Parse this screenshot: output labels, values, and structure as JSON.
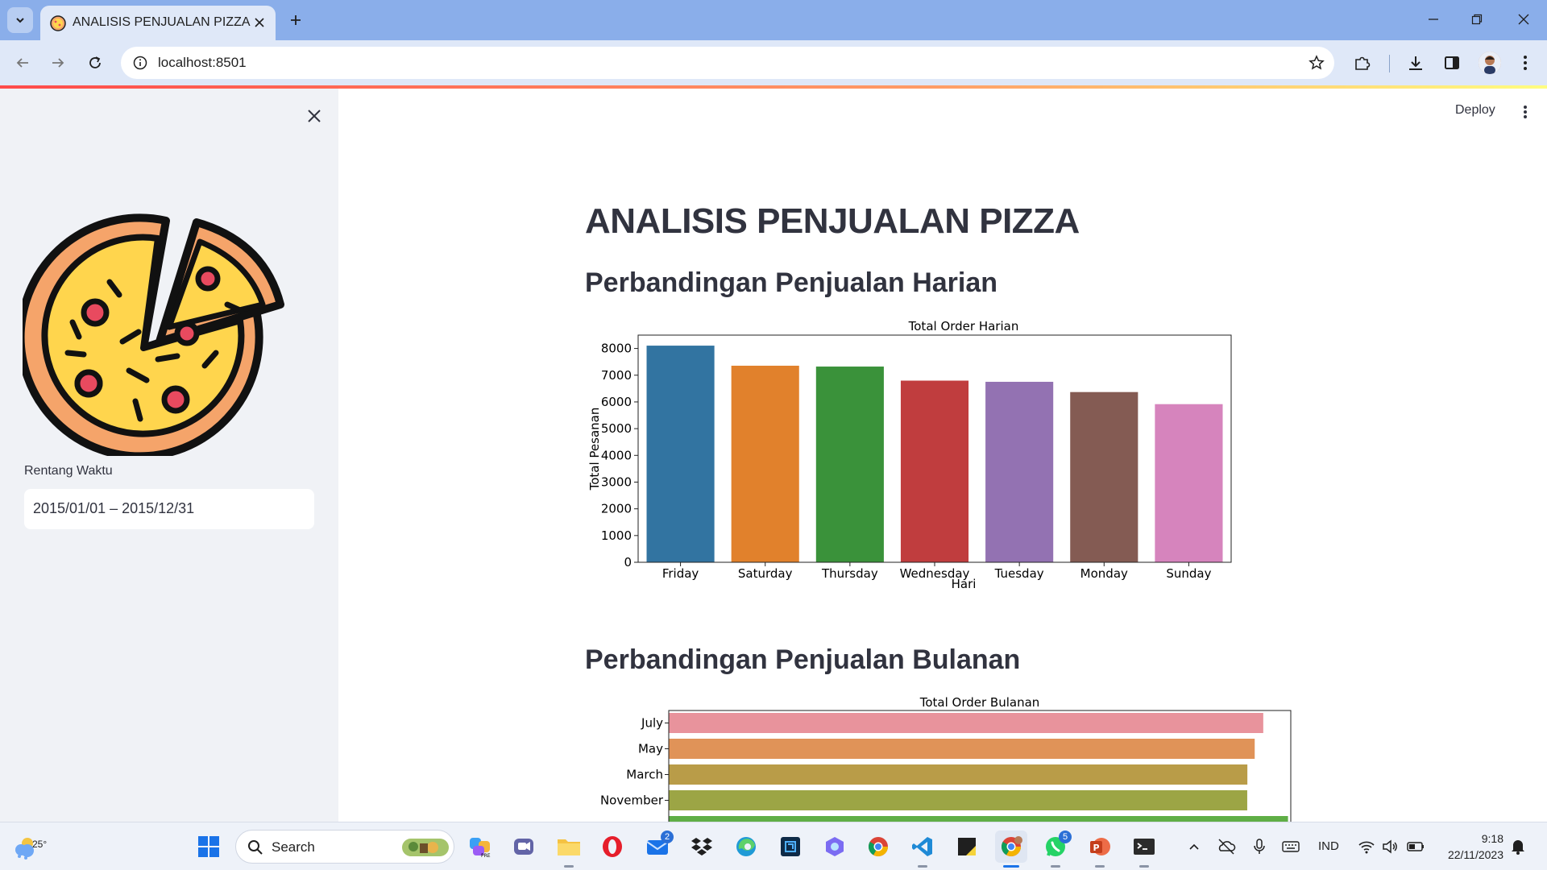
{
  "browser": {
    "tab_title": "ANALISIS PENJUALAN PIZZA",
    "url": "localhost:8501"
  },
  "sidebar": {
    "date_label": "Rentang Waktu",
    "date_value": "2015/01/01 – 2015/12/31"
  },
  "header": {
    "deploy_label": "Deploy"
  },
  "main": {
    "title": "ANALISIS PENJUALAN PIZZA",
    "section_daily": "Perbandingan Penjualan Harian",
    "section_monthly": "Perbandingan Penjualan Bulanan"
  },
  "colors": {
    "sidebar_bg": "#f0f2f6",
    "text": "#31333f",
    "accent_strip": "#ff4b4b"
  },
  "chart_data": [
    {
      "type": "bar",
      "title": "Total Order Harian",
      "xlabel": "Hari",
      "ylabel": "Total Pesanan",
      "categories": [
        "Friday",
        "Saturday",
        "Thursday",
        "Wednesday",
        "Tuesday",
        "Monday",
        "Sunday"
      ],
      "values": [
        8106,
        7355,
        7323,
        6797,
        6753,
        6369,
        5917
      ],
      "colors": [
        "#3274a1",
        "#e1812c",
        "#3a923a",
        "#c03d3e",
        "#9372b2",
        "#845b53",
        "#d684bd"
      ],
      "yticks": [
        0,
        1000,
        2000,
        3000,
        4000,
        5000,
        6000,
        7000,
        8000
      ],
      "ylim": [
        0,
        8500
      ],
      "grid": false
    },
    {
      "type": "bar",
      "orientation": "horizontal",
      "title": "Total Order Bulanan",
      "categories": [
        "July",
        "May",
        "March",
        "November"
      ],
      "values": [
        4301,
        4239,
        4186,
        4185
      ],
      "colors": [
        "#e8939c",
        "#e09358",
        "#b99c48",
        "#9ca545",
        "#5fae46"
      ],
      "grid": false
    }
  ],
  "taskbar": {
    "weather_temp": "25°",
    "search_label": "Search",
    "mail_badge": "2",
    "whatsapp_badge": "5",
    "language": "IND",
    "time": "9:18",
    "date": "22/11/2023"
  }
}
